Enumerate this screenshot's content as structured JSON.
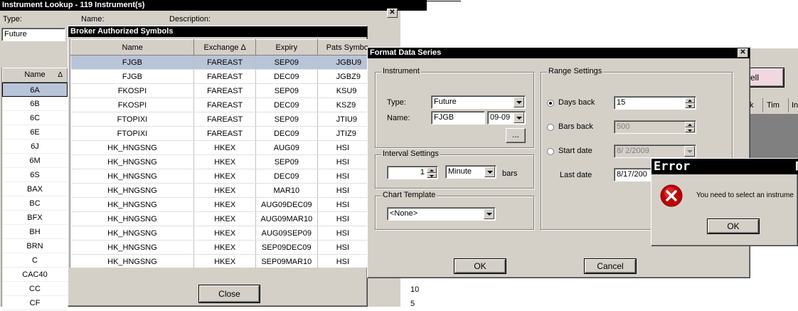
{
  "lookup": {
    "title": "Instrument Lookup - 119 Instrument(s)",
    "type_label": "Type:",
    "name_label": "Name:",
    "desc_label": "Description:",
    "type_value": "Future",
    "list_header": "Name",
    "sort_icon": "Δ",
    "items": [
      "6A",
      "6B",
      "6C",
      "6E",
      "6J",
      "6M",
      "6S",
      "BAX",
      "BC",
      "BFX",
      "BH",
      "BRN",
      "C",
      "CAC40",
      "CC",
      "CF"
    ],
    "right_values": [
      "10",
      "5"
    ]
  },
  "broker": {
    "title": "Broker Authorized Symbols",
    "columns": [
      "Name",
      "Exchange Δ",
      "Expiry",
      "Pats Symbo"
    ],
    "rows": [
      [
        "FJGB",
        "FAREAST",
        "SEP09",
        "JGBU9"
      ],
      [
        "FJGB",
        "FAREAST",
        "DEC09",
        "JGBZ9"
      ],
      [
        "FKOSPI",
        "FAREAST",
        "SEP09",
        "KSU9"
      ],
      [
        "FKOSPI",
        "FAREAST",
        "DEC09",
        "KSZ9"
      ],
      [
        "FTOPIXI",
        "FAREAST",
        "SEP09",
        "JTIU9"
      ],
      [
        "FTOPIXI",
        "FAREAST",
        "DEC09",
        "JTIZ9"
      ],
      [
        "HK_HNGSNG",
        "HKEX",
        "AUG09",
        "HSI"
      ],
      [
        "HK_HNGSNG",
        "HKEX",
        "SEP09",
        "HSI"
      ],
      [
        "HK_HNGSNG",
        "HKEX",
        "DEC09",
        "HSI"
      ],
      [
        "HK_HNGSNG",
        "HKEX",
        "MAR10",
        "HSI"
      ],
      [
        "HK_HNGSNG",
        "HKEX",
        "AUG09DEC09",
        "HSI"
      ],
      [
        "HK_HNGSNG",
        "HKEX",
        "AUG09MAR10",
        "HSI"
      ],
      [
        "HK_HNGSNG",
        "HKEX",
        "AUG09SEP09",
        "HSI"
      ],
      [
        "HK_HNGSNG",
        "HKEX",
        "SEP09DEC09",
        "HSI"
      ],
      [
        "HK_HNGSNG",
        "HKEX",
        "SEP09MAR10",
        "HSI"
      ]
    ],
    "close_label": "Close"
  },
  "format": {
    "title": "Format Data Series",
    "instrument_group": "Instrument",
    "type_label": "Type:",
    "type_value": "Future",
    "name_label": "Name:",
    "name_value": "FJGB",
    "expiry_value": "09-09",
    "browse_label": "...",
    "interval_group": "Interval Settings",
    "interval_value": "1",
    "interval_unit": "Minute",
    "bars_label": "bars",
    "template_group": "Chart Template",
    "template_value": "<None>",
    "range_group": "Range Settings",
    "days_back_label": "Days back",
    "days_back_value": "15",
    "bars_back_label": "Bars back",
    "bars_back_value": "500",
    "start_date_label": "Start date",
    "start_date_value": "8/ 2/2009",
    "last_date_label": "Last date",
    "last_date_value": "8/17/200",
    "ok_label": "OK",
    "cancel_label": "Cancel"
  },
  "bg_app": {
    "button_label": "ell",
    "col1": "k",
    "col2": "Tim",
    "col3": "In"
  },
  "error": {
    "title": "Error",
    "message": "You need to select an instrume",
    "ok_label": "OK",
    "icon": "error-icon"
  }
}
